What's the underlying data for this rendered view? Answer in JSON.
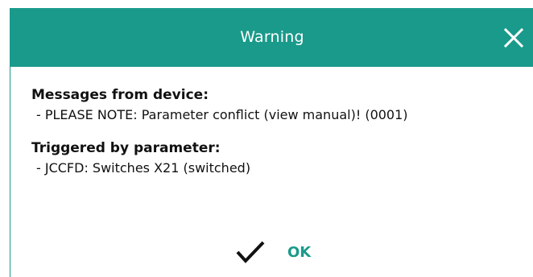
{
  "dialog": {
    "title": "Warning",
    "accent_color": "#1a9a8b",
    "close_icon": "close-icon"
  },
  "sections": [
    {
      "heading": "Messages from device:",
      "item": "- PLEASE NOTE: Parameter conflict (view manual)! (0001)"
    },
    {
      "heading": "Triggered by parameter:",
      "item": "- JCCFD: Switches X21 (switched)"
    }
  ],
  "buttons": {
    "ok_label": "OK",
    "ok_icon": "checkmark-icon"
  }
}
